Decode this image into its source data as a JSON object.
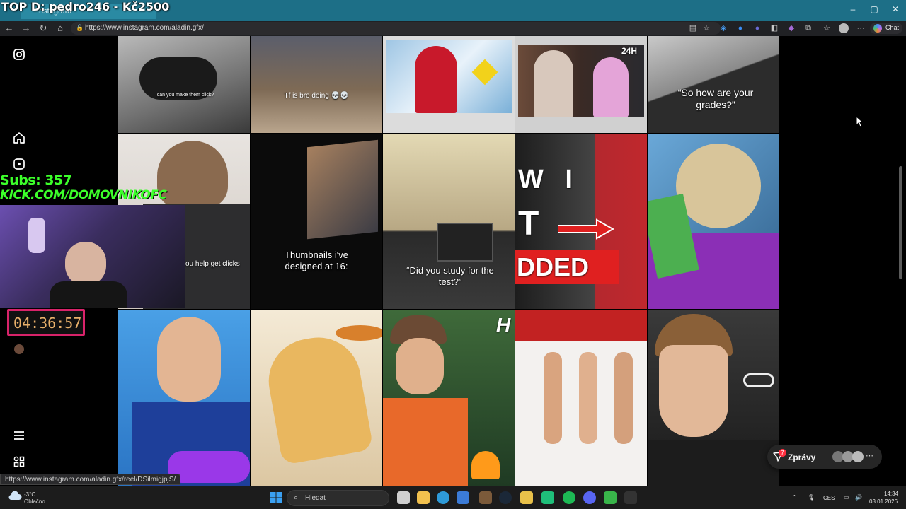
{
  "overlay": {
    "title": "TOP D: pedro246 - Kč2500",
    "subs": "Subs: 357",
    "kick": "KICK.COM/DOMOVNIKOFC",
    "timer": "04:36:57"
  },
  "browser": {
    "tab_title": "Instagram",
    "url": "https://www.instagram.com/aladin.gfx/",
    "chat_label": "Chat",
    "status_url": "https://www.instagram.com/aladin.gfx/reel/DSilmigjpjS/"
  },
  "nav": {
    "icons": [
      "instagram-logo-icon",
      "home-icon",
      "reels-icon",
      "menu-icon",
      "apps-icon"
    ]
  },
  "tiles": {
    "t1": "can you make them click?",
    "t2": "Tf is bro doing 💀💀",
    "t4": "24H",
    "t5": "“So how are your grades?”",
    "t7": "you help get clicks",
    "t8": "Thumbnails i've designed at 16:",
    "t9": "“Did you study for the test?”",
    "t10a": "W I",
    "t10b": "T",
    "t10c": "DDED",
    "t13": "H"
  },
  "messages": {
    "label": "Zprávy",
    "badge": "7"
  },
  "taskbar": {
    "temp": "-3°C",
    "weather": "Oblačno",
    "search": "Hledat",
    "lang": "CES",
    "time": "14:34",
    "date": "03.01.2026"
  },
  "colors": {
    "accent_green": "#3cff2a",
    "timer_border": "#d8236a",
    "badge_red": "#ff3040"
  }
}
